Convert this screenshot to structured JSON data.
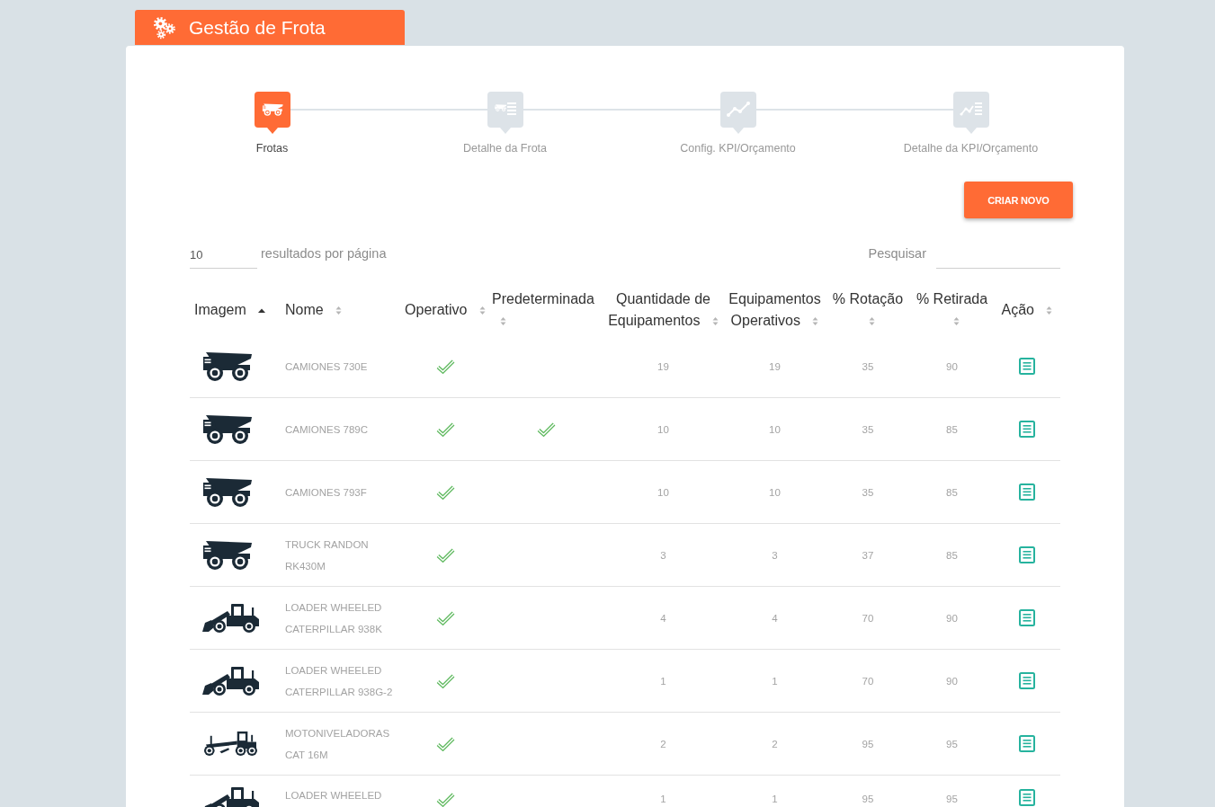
{
  "header": {
    "title": "Gestão de Frota"
  },
  "steps": [
    {
      "label": "Frotas",
      "selected": true
    },
    {
      "label": "Detalhe da Frota",
      "selected": false
    },
    {
      "label": "Config. KPI/Orçamento",
      "selected": false
    },
    {
      "label": "Detalhe da KPI/Orçamento",
      "selected": false
    }
  ],
  "create_button": {
    "label": "CRIAR NOVO"
  },
  "page_size": {
    "value": "10",
    "label": "resultados por página"
  },
  "search": {
    "label": "Pesquisar"
  },
  "table": {
    "columns": [
      {
        "label": "Imagem",
        "sorted": true
      },
      {
        "label": "Nome",
        "sorted": false
      },
      {
        "label": "Operativo",
        "sorted": false
      },
      {
        "label": "Predeterminada",
        "sorted": false
      },
      {
        "label": "Quantidade de Equipamentos",
        "sorted": false
      },
      {
        "label": "Equipamentos Operativos",
        "sorted": false
      },
      {
        "label": "% Rotação",
        "sorted": false
      },
      {
        "label": "% Retirada",
        "sorted": false
      },
      {
        "label": "Ação",
        "sorted": false
      }
    ],
    "rows": [
      {
        "kind": "truck",
        "name": "CAMIONES 730E",
        "operativo": true,
        "predeterminada": false,
        "quantidade": "19",
        "operativos": "19",
        "rotacao": "35",
        "retirada": "90"
      },
      {
        "kind": "truck",
        "name": "CAMIONES 789C",
        "operativo": true,
        "predeterminada": true,
        "quantidade": "10",
        "operativos": "10",
        "rotacao": "35",
        "retirada": "85"
      },
      {
        "kind": "truck",
        "name": "CAMIONES 793F",
        "operativo": true,
        "predeterminada": false,
        "quantidade": "10",
        "operativos": "10",
        "rotacao": "35",
        "retirada": "85"
      },
      {
        "kind": "truck",
        "name": "TRUCK RANDON RK430M",
        "operativo": true,
        "predeterminada": false,
        "quantidade": "3",
        "operativos": "3",
        "rotacao": "37",
        "retirada": "85"
      },
      {
        "kind": "loader",
        "name": "LOADER WHEELED CATERPILLAR 938K",
        "operativo": true,
        "predeterminada": false,
        "quantidade": "4",
        "operativos": "4",
        "rotacao": "70",
        "retirada": "90"
      },
      {
        "kind": "loader",
        "name": "LOADER WHEELED CATERPILLAR 938G-2",
        "operativo": true,
        "predeterminada": false,
        "quantidade": "1",
        "operativos": "1",
        "rotacao": "70",
        "retirada": "90"
      },
      {
        "kind": "grader",
        "name": "MOTONIVELADORAS CAT 16M",
        "operativo": true,
        "predeterminada": false,
        "quantidade": "2",
        "operativos": "2",
        "rotacao": "95",
        "retirada": "95"
      },
      {
        "kind": "loader",
        "name": "LOADER WHEELED",
        "operativo": true,
        "predeterminada": false,
        "quantidade": "1",
        "operativos": "1",
        "rotacao": "95",
        "retirada": "95"
      }
    ]
  }
}
